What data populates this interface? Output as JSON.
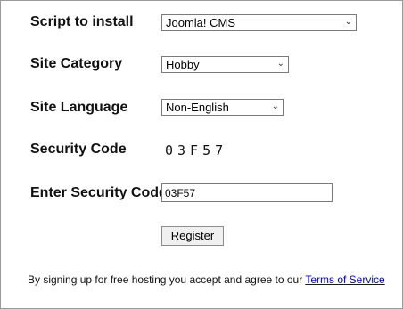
{
  "form": {
    "script": {
      "label": "Script to install",
      "value": "Joomla! CMS"
    },
    "category": {
      "label": "Site Category",
      "value": "Hobby"
    },
    "language": {
      "label": "Site Language",
      "value": "Non-English"
    },
    "security": {
      "label": "Security Code",
      "code": "03F57"
    },
    "enter_code": {
      "label": "Enter Security Code",
      "value": "03F57"
    },
    "register_label": "Register"
  },
  "footer": {
    "text": "By signing up for free hosting you accept and agree to our ",
    "link": "Terms of Service"
  }
}
